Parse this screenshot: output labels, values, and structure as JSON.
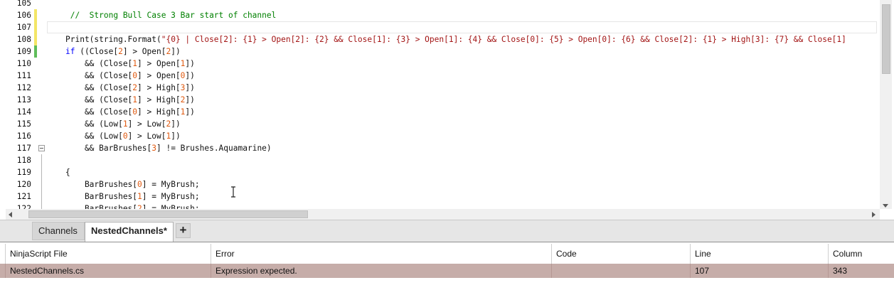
{
  "editor": {
    "lines": [
      {
        "num": "105",
        "segments": []
      },
      {
        "num": "106",
        "segments": [
          {
            "t": "cmt",
            "v": " //  Strong Bull Case 3 Bar start of channel"
          }
        ],
        "mark": "yellow"
      },
      {
        "num": "107",
        "segments": [],
        "mark": "yellow",
        "current": true
      },
      {
        "num": "108",
        "segments": [
          {
            "t": "",
            "v": "Print(string.Format("
          },
          {
            "t": "str",
            "v": "\"{0} | Close[2]: {1} > Open[2]: {2} && Close[1]: {3} > Open[1]: {4} && Close[0]: {5} > Open[0]: {6} && Close[2]: {1} > High[3]: {7} && Close[1]"
          }
        ],
        "mark": "yellow"
      },
      {
        "num": "109",
        "segments": [
          {
            "t": "kw",
            "v": "if"
          },
          {
            "t": "",
            "v": " ((Close["
          },
          {
            "t": "num",
            "v": "2"
          },
          {
            "t": "",
            "v": "] > Open["
          },
          {
            "t": "num",
            "v": "2"
          },
          {
            "t": "",
            "v": "])"
          }
        ],
        "mark": "green"
      },
      {
        "num": "110",
        "segments": [
          {
            "t": "",
            "v": "    && (Close["
          },
          {
            "t": "num",
            "v": "1"
          },
          {
            "t": "",
            "v": "] > Open["
          },
          {
            "t": "num",
            "v": "1"
          },
          {
            "t": "",
            "v": "])"
          }
        ]
      },
      {
        "num": "111",
        "segments": [
          {
            "t": "",
            "v": "    && (Close["
          },
          {
            "t": "num",
            "v": "0"
          },
          {
            "t": "",
            "v": "] > Open["
          },
          {
            "t": "num",
            "v": "0"
          },
          {
            "t": "",
            "v": "])"
          }
        ]
      },
      {
        "num": "112",
        "segments": [
          {
            "t": "",
            "v": "    && (Close["
          },
          {
            "t": "num",
            "v": "2"
          },
          {
            "t": "",
            "v": "] > High["
          },
          {
            "t": "num",
            "v": "3"
          },
          {
            "t": "",
            "v": "])"
          }
        ]
      },
      {
        "num": "113",
        "segments": [
          {
            "t": "",
            "v": "    && (Close["
          },
          {
            "t": "num",
            "v": "1"
          },
          {
            "t": "",
            "v": "] > High["
          },
          {
            "t": "num",
            "v": "2"
          },
          {
            "t": "",
            "v": "])"
          }
        ]
      },
      {
        "num": "114",
        "segments": [
          {
            "t": "",
            "v": "    && (Close["
          },
          {
            "t": "num",
            "v": "0"
          },
          {
            "t": "",
            "v": "] > High["
          },
          {
            "t": "num",
            "v": "1"
          },
          {
            "t": "",
            "v": "])"
          }
        ]
      },
      {
        "num": "115",
        "segments": [
          {
            "t": "",
            "v": "    && (Low["
          },
          {
            "t": "num",
            "v": "1"
          },
          {
            "t": "",
            "v": "] > Low["
          },
          {
            "t": "num",
            "v": "2"
          },
          {
            "t": "",
            "v": "])"
          }
        ]
      },
      {
        "num": "116",
        "segments": [
          {
            "t": "",
            "v": "    && (Low["
          },
          {
            "t": "num",
            "v": "0"
          },
          {
            "t": "",
            "v": "] > Low["
          },
          {
            "t": "num",
            "v": "1"
          },
          {
            "t": "",
            "v": "])"
          }
        ]
      },
      {
        "num": "117",
        "segments": [
          {
            "t": "",
            "v": "    && BarBrushes["
          },
          {
            "t": "num",
            "v": "3"
          },
          {
            "t": "",
            "v": "] != Brushes.Aquamarine)"
          }
        ],
        "collapse": true
      },
      {
        "num": "118",
        "segments": []
      },
      {
        "num": "119",
        "segments": [
          {
            "t": "",
            "v": "{"
          }
        ]
      },
      {
        "num": "120",
        "segments": [
          {
            "t": "",
            "v": "    BarBrushes["
          },
          {
            "t": "num",
            "v": "0"
          },
          {
            "t": "",
            "v": "] = MyBrush;"
          }
        ]
      },
      {
        "num": "121",
        "segments": [
          {
            "t": "",
            "v": "    BarBrushes["
          },
          {
            "t": "num",
            "v": "1"
          },
          {
            "t": "",
            "v": "] = MyBrush;"
          }
        ]
      },
      {
        "num": "122",
        "segments": [
          {
            "t": "",
            "v": "    BarBrushes["
          },
          {
            "t": "num",
            "v": "2"
          },
          {
            "t": "",
            "v": "] = MyBrush;"
          }
        ]
      }
    ]
  },
  "tabs": {
    "items": [
      {
        "label": "Channels",
        "active": false
      },
      {
        "label": "NestedChannels*",
        "active": true
      }
    ],
    "add_label": "+"
  },
  "errors": {
    "headers": {
      "file": "NinjaScript File",
      "error": "Error",
      "code": "Code",
      "line": "Line",
      "column": "Column"
    },
    "rows": [
      {
        "file": "NestedChannels.cs",
        "error": "Expression expected.",
        "code": "",
        "line": "107",
        "column": "343"
      }
    ]
  },
  "colors": {
    "keyword": "#0000ff",
    "string": "#a31515",
    "number": "#e05a10",
    "comment": "#008000",
    "error_row": "#c6ada9",
    "change_saved": "#5fbd5a",
    "change_unsaved": "#f3e666"
  }
}
